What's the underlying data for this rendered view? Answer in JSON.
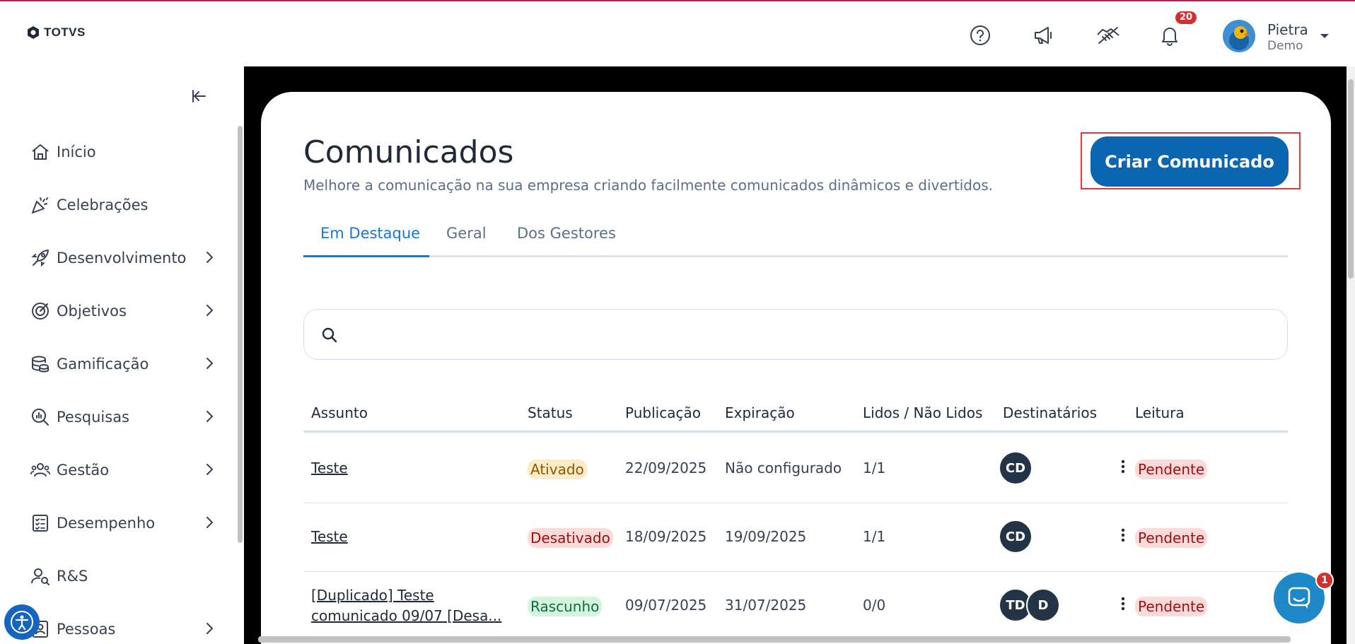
{
  "brand": {
    "logo_text": "TOTVS"
  },
  "header": {
    "notifications_count": "20",
    "user": {
      "name": "Pietra",
      "subtitle": "Demo"
    },
    "icons": [
      "help-icon",
      "megaphone-icon",
      "handshake-icon",
      "bell-icon"
    ]
  },
  "sidebar": {
    "items": [
      {
        "label": "Início",
        "icon": "home-icon",
        "has_children": false
      },
      {
        "label": "Celebrações",
        "icon": "party-icon",
        "has_children": false
      },
      {
        "label": "Desenvolvimento",
        "icon": "rocket-icon",
        "has_children": true
      },
      {
        "label": "Objetivos",
        "icon": "target-icon",
        "has_children": true
      },
      {
        "label": "Gamificação",
        "icon": "coins-icon",
        "has_children": true
      },
      {
        "label": "Pesquisas",
        "icon": "search-chart-icon",
        "has_children": true
      },
      {
        "label": "Gestão",
        "icon": "people-icon",
        "has_children": true
      },
      {
        "label": "Desempenho",
        "icon": "checklist-icon",
        "has_children": true
      },
      {
        "label": "R&S",
        "icon": "person-search-icon",
        "has_children": false
      },
      {
        "label": "Pessoas",
        "icon": "contacts-icon",
        "has_children": true
      }
    ]
  },
  "page": {
    "title": "Comunicados",
    "subtitle": "Melhore a comunicação na sua empresa criando facilmente comunicados dinâmicos e divertidos.",
    "create_button": "Criar Comunicado",
    "tabs": [
      {
        "label": "Em Destaque",
        "active": true
      },
      {
        "label": "Geral",
        "active": false
      },
      {
        "label": "Dos Gestores",
        "active": false
      }
    ],
    "search_placeholder": ""
  },
  "table": {
    "columns": [
      "Assunto",
      "Status",
      "Publicação",
      "Expiração",
      "Lidos / Não Lidos",
      "Destinatários",
      "Leitura"
    ],
    "rows": [
      {
        "subject": "Teste",
        "subject_line2": "",
        "status": "Ativado",
        "published": "22/09/2025",
        "expires": "Não configurado",
        "read": "1/1",
        "recipients": [
          "CD"
        ],
        "reading": "Pendente"
      },
      {
        "subject": "Teste",
        "subject_line2": "",
        "status": "Desativado",
        "published": "18/09/2025",
        "expires": "19/09/2025",
        "read": "1/1",
        "recipients": [
          "CD"
        ],
        "reading": "Pendente"
      },
      {
        "subject": "[Duplicado] Teste",
        "subject_line2": "comunicado 09/07 [Desa...",
        "status": "Rascunho",
        "published": "09/07/2025",
        "expires": "31/07/2025",
        "read": "0/0",
        "recipients": [
          "TD",
          "D"
        ],
        "reading": "Pendente"
      }
    ]
  },
  "chat": {
    "unread": "1"
  },
  "colors": {
    "primary": "#0b66b2",
    "tab_active": "#1976d2",
    "badge": "#d32f2f",
    "highlight_border": "#e53935"
  }
}
